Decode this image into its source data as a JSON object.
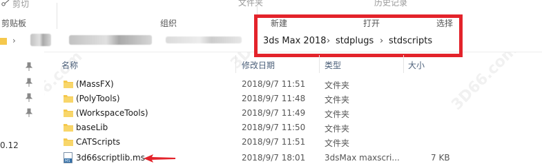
{
  "ribbon": {
    "cut": "剪切",
    "clipboard": "剪贴板",
    "file_ops_top": "文件夹",
    "organize": "组织",
    "history_top": "历史记录",
    "new": "新建",
    "open": "打开",
    "select": "选择"
  },
  "address": {
    "crumbs": [
      "3ds Max 2018",
      "stdplugs",
      "stdscripts"
    ],
    "separator": "›"
  },
  "nav": {
    "left_clip": "0.12"
  },
  "columns": {
    "name": "名称",
    "date": "修改日期",
    "type": "类型",
    "size": "大小"
  },
  "files": [
    {
      "name": "(MassFX)",
      "date": "2018/9/7 11:51",
      "type": "文件夹",
      "size": "",
      "kind": "folder"
    },
    {
      "name": "(PolyTools)",
      "date": "2018/9/7 11:48",
      "type": "文件夹",
      "size": "",
      "kind": "folder"
    },
    {
      "name": "(WorkspaceTools)",
      "date": "2018/9/7 11:49",
      "type": "文件夹",
      "size": "",
      "kind": "folder"
    },
    {
      "name": "baseLib",
      "date": "2018/9/7 11:50",
      "type": "文件夹",
      "size": "",
      "kind": "folder"
    },
    {
      "name": "CATScripts",
      "date": "2018/9/7 11:51",
      "type": "文件夹",
      "size": "",
      "kind": "folder"
    },
    {
      "name": "3d66scriptlib.ms",
      "date": "2018/9/7 18:01",
      "type": "3dsMax maxscri...",
      "size": "7 KB",
      "kind": "ms-file"
    }
  ],
  "colors": {
    "highlight_box": "#e3232b",
    "folder_yellow": "#f5c84c",
    "header_text": "#4c607a"
  },
  "watermark": "3D66.com"
}
